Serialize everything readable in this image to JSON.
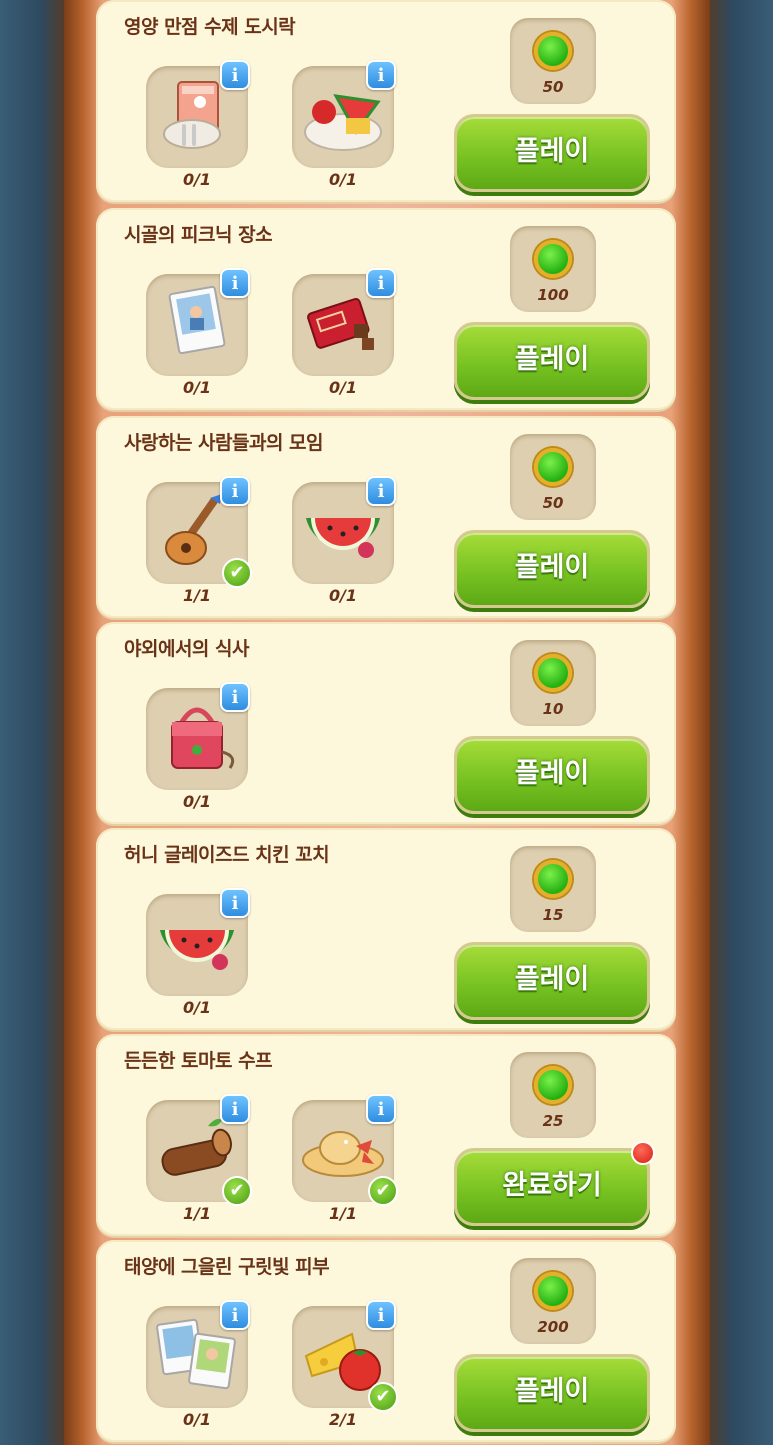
{
  "quests": [
    {
      "title": "영양 만점 수제 도시락",
      "items": [
        {
          "icon": "notebook-utensils-icon",
          "count": "0/1",
          "done": false
        },
        {
          "icon": "fruit-platter-icon",
          "count": "0/1",
          "done": false
        }
      ],
      "reward": "50",
      "button": "플레이",
      "notify": false
    },
    {
      "title": "시골의 피크닉 장소",
      "items": [
        {
          "icon": "photo-icon",
          "count": "0/1",
          "done": false
        },
        {
          "icon": "chocolate-bar-icon",
          "count": "0/1",
          "done": false
        }
      ],
      "reward": "100",
      "button": "플레이",
      "notify": false
    },
    {
      "title": "사랑하는 사람들과의 모임",
      "items": [
        {
          "icon": "guitar-icon",
          "count": "1/1",
          "done": true
        },
        {
          "icon": "watermelon-icon",
          "count": "0/1",
          "done": false
        }
      ],
      "reward": "50",
      "button": "플레이",
      "notify": false
    },
    {
      "title": "야외에서의 식사",
      "items": [
        {
          "icon": "handbag-icon",
          "count": "0/1",
          "done": false
        }
      ],
      "reward": "10",
      "button": "플레이",
      "notify": false
    },
    {
      "title": "허니 글레이즈드 치킨 꼬치",
      "items": [
        {
          "icon": "watermelon-icon",
          "count": "0/1",
          "done": false
        }
      ],
      "reward": "15",
      "button": "플레이",
      "notify": false
    },
    {
      "title": "든든한 토마토 수프",
      "items": [
        {
          "icon": "log-icon",
          "count": "1/1",
          "done": true
        },
        {
          "icon": "sun-hat-icon",
          "count": "1/1",
          "done": true
        }
      ],
      "reward": "25",
      "button": "완료하기",
      "notify": true
    },
    {
      "title": "태양에 그을린 구릿빛 피부",
      "items": [
        {
          "icon": "photos-icon",
          "count": "0/1",
          "done": false
        },
        {
          "icon": "cheese-tomato-icon",
          "count": "2/1",
          "done": true
        }
      ],
      "reward": "200",
      "button": "플레이",
      "notify": false
    }
  ]
}
